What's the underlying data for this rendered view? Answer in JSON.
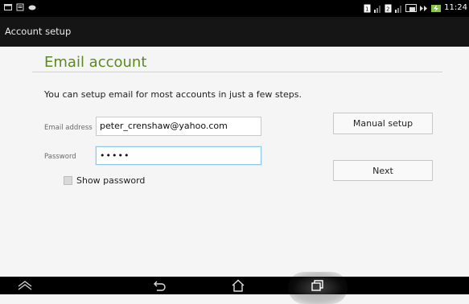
{
  "status_bar": {
    "time": "11:24",
    "left_icons": [
      "notification-icon",
      "message-icon",
      "gamepad-icon"
    ],
    "right_icons": [
      "sim-icon",
      "signal-icon",
      "sim-icon",
      "signal-icon",
      "cast-icon",
      "fast-forward-icon",
      "battery-charging-icon"
    ]
  },
  "action_bar": {
    "title": "Account setup"
  },
  "main": {
    "heading": "Email account",
    "instructions": "You can setup email for most accounts in just a few steps.",
    "email": {
      "label": "Email address",
      "value": "peter_crenshaw@yahoo.com"
    },
    "password": {
      "label": "Password",
      "value": "•••••"
    },
    "show_password_label": "Show password",
    "manual_setup_label": "Manual setup",
    "next_label": "Next"
  },
  "nav_bar": {
    "icons": [
      "collapse-icon",
      "back-icon",
      "home-icon",
      "recent-apps-icon"
    ]
  },
  "colors": {
    "accent_green": "#5b8a1f",
    "status_bar": "#000000",
    "action_bar": "#151515",
    "focus_blue": "#8fc7e8"
  }
}
